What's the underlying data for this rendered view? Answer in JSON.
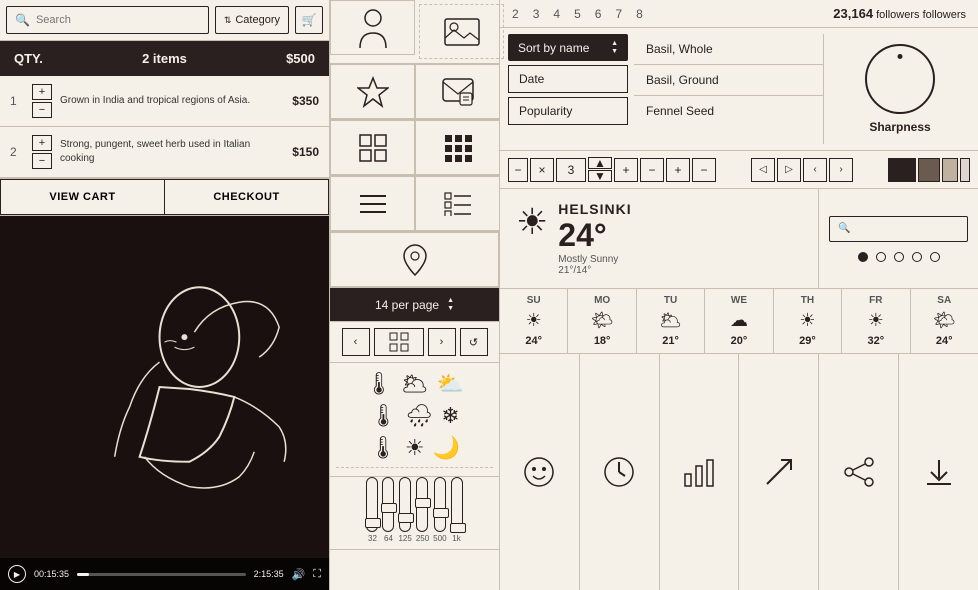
{
  "search": {
    "placeholder": "Search",
    "category_label": "Category"
  },
  "cart": {
    "qty_label": "QTY.",
    "items_count": "2 items",
    "total": "$500",
    "item1": {
      "num": "1",
      "desc": "Grown in India and tropical regions of Asia.",
      "price": "$350"
    },
    "item2": {
      "num": "2",
      "desc": "Strong, pungent, sweet herb used in Italian cooking",
      "price": "$150"
    },
    "view_cart": "VIEW CART",
    "checkout": "CHECKOUT"
  },
  "video": {
    "time_current": "00:15:35",
    "time_total": "2:15:35"
  },
  "pagination": {
    "per_page_label": "14 per page",
    "prev": "‹",
    "next": "›"
  },
  "sort": {
    "label": "Sort by name",
    "arrow_up": "▲",
    "arrow_down": "▼"
  },
  "filter_options": [
    "Date",
    "Popularity"
  ],
  "herbs": [
    "Basil, Whole",
    "Basil, Ground",
    "Fennel Seed"
  ],
  "sharpness": {
    "label": "Sharpness"
  },
  "numbers_row": [
    "2",
    "3",
    "4",
    "5",
    "6",
    "7",
    "8"
  ],
  "followers": {
    "count": "23,164",
    "label": "followers"
  },
  "controls": {
    "number_display": "3",
    "plus": "+",
    "minus": "−",
    "cross": "×"
  },
  "weather": {
    "city": "HELSINKI",
    "temp": "24°",
    "desc": "Mostly Sunny",
    "range": "21°/14°"
  },
  "weekly": [
    {
      "day": "SU",
      "icon": "☀",
      "temp": "24°"
    },
    {
      "day": "MO",
      "icon": "🌤",
      "temp": "18°"
    },
    {
      "day": "TU",
      "icon": "🌥",
      "temp": "21°"
    },
    {
      "day": "WE",
      "icon": "☁",
      "temp": "20°"
    },
    {
      "day": "TH",
      "icon": "☀",
      "temp": "29°"
    },
    {
      "day": "FR",
      "icon": "☀",
      "temp": "32°"
    },
    {
      "day": "SA",
      "icon": "🌤",
      "temp": "24°"
    }
  ],
  "eq_labels": [
    "32",
    "64",
    "125",
    "250",
    "500",
    "1k"
  ],
  "eq_positions": [
    40,
    25,
    35,
    20,
    30,
    45
  ],
  "colors": {
    "bg": "#f5f0e8",
    "dark": "#2a2020",
    "mid": "#c8bfb0"
  }
}
